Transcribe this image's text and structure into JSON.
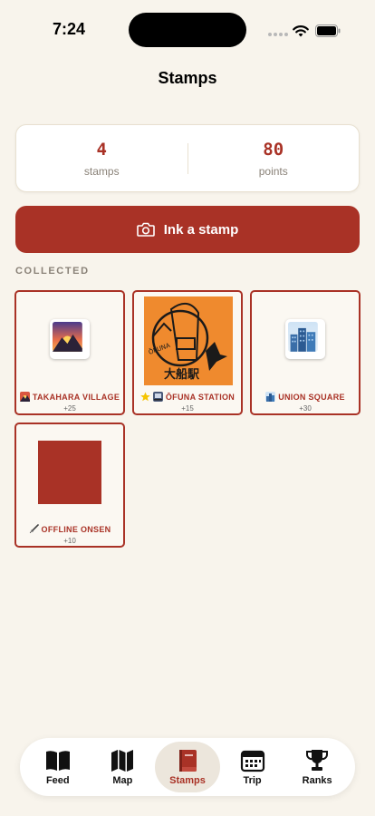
{
  "status": {
    "time": "7:24"
  },
  "title": "Stamps",
  "summary": {
    "stamps_value": "4",
    "stamps_label": "stamps",
    "points_value": "80",
    "points_label": "points"
  },
  "ink_button": {
    "label": "Ink a stamp",
    "icon": "camera-icon"
  },
  "section_label": "COLLECTED",
  "stamps": [
    {
      "name": "TAKAHARA VILLAGE",
      "points": "+25",
      "art": "sunrise-over-mountains-emoji"
    },
    {
      "name": "ŌFUNA STATION",
      "points": "+15",
      "art": "ofuna-station-stamp-image",
      "art_text": "ŌFUNA",
      "art_kanji": "大船駅"
    },
    {
      "name": "UNION SQUARE",
      "points": "+30",
      "art": "cityscape-emoji"
    },
    {
      "name": "OFFLINE ONSEN",
      "points": "+10",
      "art": "red-placeholder-square"
    }
  ],
  "tabs": [
    {
      "label": "Feed",
      "icon": "book-open-icon",
      "active": false
    },
    {
      "label": "Map",
      "icon": "map-icon",
      "active": false
    },
    {
      "label": "Stamps",
      "icon": "stamp-book-icon",
      "active": true
    },
    {
      "label": "Trip",
      "icon": "calendar-icon",
      "active": false
    },
    {
      "label": "Ranks",
      "icon": "trophy-icon",
      "active": false
    }
  ],
  "colors": {
    "accent": "#a93226",
    "background": "#f8f4ec",
    "muted": "#8a8278"
  }
}
